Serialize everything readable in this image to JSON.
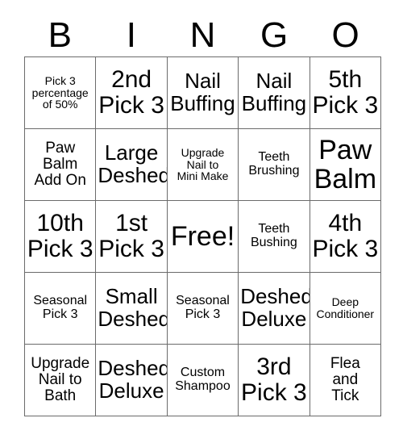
{
  "card": {
    "header_letters": [
      "B",
      "I",
      "N",
      "G",
      "O"
    ],
    "rows": [
      [
        {
          "text": "Pick 3\npercentage\nof 50%",
          "size": "xs"
        },
        {
          "text": "2nd\nPick 3",
          "size": "xl"
        },
        {
          "text": "Nail\nBuffing",
          "size": "l"
        },
        {
          "text": "Nail\nBuffing",
          "size": "l"
        },
        {
          "text": "5th\nPick 3",
          "size": "xl"
        }
      ],
      [
        {
          "text": "Paw\nBalm\nAdd On",
          "size": "m"
        },
        {
          "text": "Large\nDeshed",
          "size": "l"
        },
        {
          "text": "Upgrade\nNail to\nMini Make",
          "size": "xs"
        },
        {
          "text": "Teeth\nBrushing",
          "size": "s"
        },
        {
          "text": "Paw\nBalm",
          "size": "xxl"
        }
      ],
      [
        {
          "text": "10th\nPick 3",
          "size": "xl"
        },
        {
          "text": "1st\nPick 3",
          "size": "xl"
        },
        {
          "text": "Free!",
          "size": "xxl"
        },
        {
          "text": "Teeth\nBushing",
          "size": "s"
        },
        {
          "text": "4th\nPick 3",
          "size": "xl"
        }
      ],
      [
        {
          "text": "Seasonal\nPick 3",
          "size": "s"
        },
        {
          "text": "Small\nDeshed",
          "size": "l"
        },
        {
          "text": "Seasonal\nPick 3",
          "size": "s"
        },
        {
          "text": "Deshed\nDeluxe",
          "size": "l"
        },
        {
          "text": "Deep\nConditioner",
          "size": "xs"
        }
      ],
      [
        {
          "text": "Upgrade\nNail to\nBath",
          "size": "m"
        },
        {
          "text": "Deshed\nDeluxe",
          "size": "l"
        },
        {
          "text": "Custom\nShampoo",
          "size": "s"
        },
        {
          "text": "3rd\nPick 3",
          "size": "xl"
        },
        {
          "text": "Flea\nand\nTick",
          "size": "m"
        }
      ]
    ]
  },
  "colors": {
    "grid_line": "#6b6b6b",
    "text": "#000000",
    "background": "#ffffff"
  }
}
